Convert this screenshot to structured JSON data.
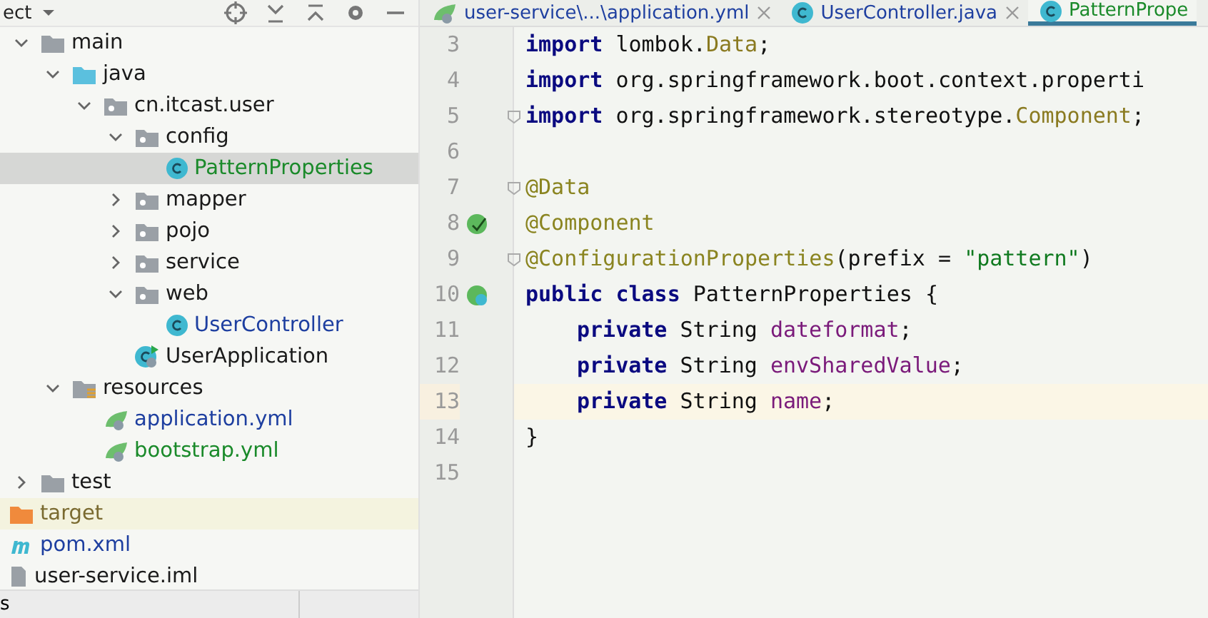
{
  "project_panel": {
    "title": "ect",
    "tree": [
      {
        "label": "main",
        "kind": "folder",
        "expanded": true,
        "selected": false,
        "children": [
          {
            "label": "java",
            "kind": "source-folder",
            "expanded": true,
            "selected": false,
            "children": [
              {
                "label": "cn.itcast.user",
                "kind": "package",
                "expanded": true,
                "selected": false,
                "children": [
                  {
                    "label": "config",
                    "kind": "package",
                    "expanded": true,
                    "selected": false,
                    "children": [
                      {
                        "label": "PatternProperties",
                        "kind": "class",
                        "color": "#1a8a2a",
                        "selected": true
                      }
                    ]
                  },
                  {
                    "label": "mapper",
                    "kind": "package",
                    "expanded": false,
                    "selected": false
                  },
                  {
                    "label": "pojo",
                    "kind": "package",
                    "expanded": false,
                    "selected": false
                  },
                  {
                    "label": "service",
                    "kind": "package",
                    "expanded": false,
                    "selected": false
                  },
                  {
                    "label": "web",
                    "kind": "package",
                    "expanded": true,
                    "selected": false,
                    "children": [
                      {
                        "label": "UserController",
                        "kind": "class",
                        "color": "#1e3fa0",
                        "selected": false
                      }
                    ]
                  },
                  {
                    "label": "UserApplication",
                    "kind": "spring-class",
                    "selected": false
                  }
                ]
              }
            ]
          },
          {
            "label": "resources",
            "kind": "resources-folder",
            "expanded": true,
            "selected": false,
            "children": [
              {
                "label": "application.yml",
                "kind": "yml",
                "color": "#1e3fa0",
                "selected": false
              },
              {
                "label": "bootstrap.yml",
                "kind": "yml",
                "color": "#1a8a2a",
                "selected": false
              }
            ]
          }
        ]
      },
      {
        "label": "test",
        "kind": "folder",
        "expanded": false,
        "selected": false
      },
      {
        "label": "target",
        "kind": "excluded-folder",
        "color": "#7a6a30",
        "selected": false
      },
      {
        "label": "pom.xml",
        "kind": "maven",
        "color": "#1e3fa0",
        "selected": false
      },
      {
        "label": "user-service.iml",
        "kind": "iml",
        "selected": false
      }
    ],
    "status_text": "s"
  },
  "editor": {
    "tabs": [
      {
        "label": "user-service\\...\\application.yml",
        "kind": "yml",
        "color": "#1e3fa0",
        "selected": false
      },
      {
        "label": "UserController.java",
        "kind": "class",
        "color": "#1e3fa0",
        "selected": false
      },
      {
        "label": "PatternPrope",
        "kind": "class",
        "color": "#1a8a2a",
        "selected": true
      }
    ],
    "lines": [
      {
        "number": "3",
        "current": false,
        "tokens": [
          {
            "text": "import",
            "kind": "keyword"
          },
          {
            "text": " lombok.",
            "kind": "plain"
          },
          {
            "text": "Data",
            "kind": "type"
          },
          {
            "text": ";",
            "kind": "plain"
          }
        ]
      },
      {
        "number": "4",
        "current": false,
        "tokens": [
          {
            "text": "import",
            "kind": "keyword"
          },
          {
            "text": " org.springframework.boot.context.properti",
            "kind": "plain"
          }
        ]
      },
      {
        "number": "5",
        "current": false,
        "fold": true,
        "tokens": [
          {
            "text": "import",
            "kind": "keyword"
          },
          {
            "text": " org.springframework.stereotype.",
            "kind": "plain"
          },
          {
            "text": "Component",
            "kind": "type"
          },
          {
            "text": ";",
            "kind": "plain"
          }
        ]
      },
      {
        "number": "6",
        "current": false
      },
      {
        "number": "7",
        "current": false,
        "fold": true,
        "tokens": [
          {
            "text": "@Data",
            "kind": "annotation"
          }
        ]
      },
      {
        "number": "8",
        "current": false,
        "gutter_icon": {
          "kind": "bean"
        },
        "tokens": [
          {
            "text": "@Component",
            "kind": "annotation"
          }
        ]
      },
      {
        "number": "9",
        "current": false,
        "fold": true,
        "tokens": [
          {
            "text": "@ConfigurationProperties",
            "kind": "annotation"
          },
          {
            "text": "(prefix = ",
            "kind": "plain"
          },
          {
            "text": "\"pattern\"",
            "kind": "string"
          },
          {
            "text": ")",
            "kind": "plain"
          }
        ]
      },
      {
        "number": "10",
        "current": false,
        "gutter_icon": {
          "kind": "spring-class"
        },
        "tokens": [
          {
            "text": "public class",
            "kind": "keyword"
          },
          {
            "text": " PatternProperties {",
            "kind": "plain"
          }
        ],
        "children": [
          {
            "number": "11",
            "current": false,
            "tokens": [
              {
                "text": "private",
                "kind": "keyword"
              },
              {
                "text": " String ",
                "kind": "plain"
              },
              {
                "text": "dateformat",
                "kind": "field"
              },
              {
                "text": ";",
                "kind": "plain"
              }
            ]
          },
          {
            "number": "12",
            "current": false,
            "tokens": [
              {
                "text": "private",
                "kind": "keyword"
              },
              {
                "text": " String ",
                "kind": "plain"
              },
              {
                "text": "envSharedValue",
                "kind": "field"
              },
              {
                "text": ";",
                "kind": "plain"
              }
            ]
          },
          {
            "number": "13",
            "current": true,
            "tokens": [
              {
                "text": "private",
                "kind": "keyword"
              },
              {
                "text": " String ",
                "kind": "plain"
              },
              {
                "text": "name",
                "kind": "field"
              },
              {
                "text": ";",
                "kind": "plain"
              }
            ]
          }
        ]
      },
      {
        "number": "14",
        "current": false,
        "tokens": [
          {
            "text": "}",
            "kind": "plain"
          }
        ]
      },
      {
        "number": "15",
        "current": false
      }
    ]
  }
}
